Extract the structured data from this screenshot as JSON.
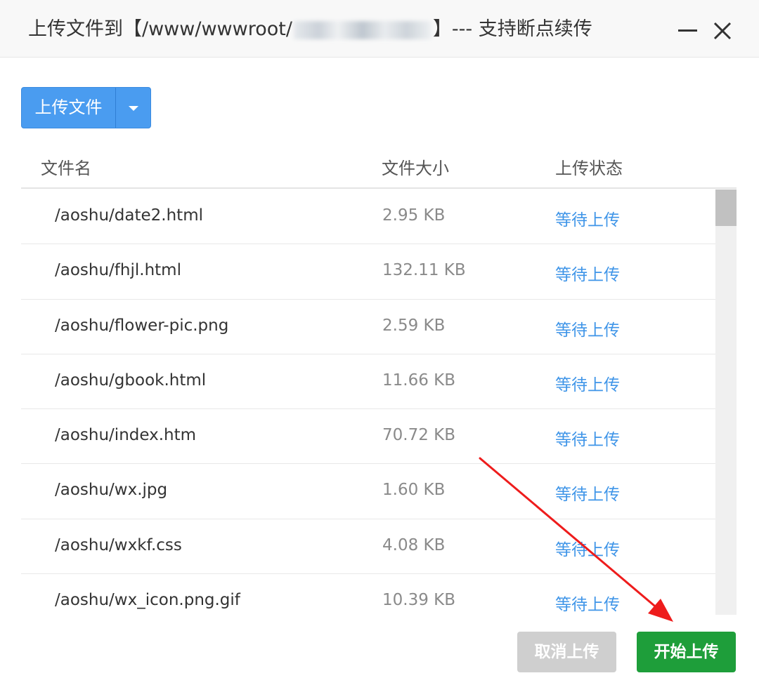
{
  "dialog": {
    "title_prefix": "上传文件到【/www/wwwroot/",
    "title_suffix": "】--- 支持断点续传"
  },
  "toolbar": {
    "upload_label": "上传文件"
  },
  "table": {
    "headers": [
      "文件名",
      "文件大小",
      "上传状态"
    ],
    "rows": [
      {
        "name": "/aoshu/date2.html",
        "size": "2.95 KB",
        "status": "等待上传"
      },
      {
        "name": "/aoshu/fhjl.html",
        "size": "132.11 KB",
        "status": "等待上传"
      },
      {
        "name": "/aoshu/flower-pic.png",
        "size": "2.59 KB",
        "status": "等待上传"
      },
      {
        "name": "/aoshu/gbook.html",
        "size": "11.66 KB",
        "status": "等待上传"
      },
      {
        "name": "/aoshu/index.htm",
        "size": "70.72 KB",
        "status": "等待上传"
      },
      {
        "name": "/aoshu/wx.jpg",
        "size": "1.60 KB",
        "status": "等待上传"
      },
      {
        "name": "/aoshu/wxkf.css",
        "size": "4.08 KB",
        "status": "等待上传"
      },
      {
        "name": "/aoshu/wx_icon.png.gif",
        "size": "10.39 KB",
        "status": "等待上传"
      }
    ]
  },
  "footer": {
    "cancel_label": "取消上传",
    "start_label": "开始上传"
  },
  "colors": {
    "primary": "#4a9cf0",
    "success": "#1e9e3a",
    "status_text": "#3f95e8",
    "disabled": "#cfcfcf",
    "annotation": "#ee1c1c"
  }
}
